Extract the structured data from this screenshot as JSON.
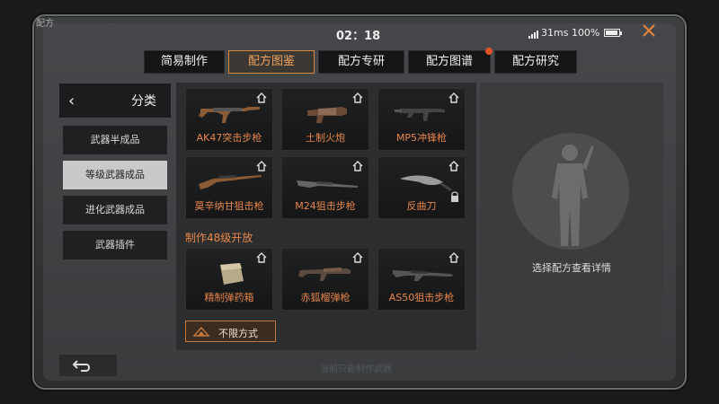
{
  "status": {
    "title": "配方",
    "clock": "02：18",
    "network": "31ms 100%"
  },
  "tabs": [
    {
      "label": "简易制作",
      "active": false
    },
    {
      "label": "配方图鉴",
      "active": true
    },
    {
      "label": "配方专研",
      "active": false
    },
    {
      "label": "配方图谱",
      "active": false,
      "badge": true
    },
    {
      "label": "配方研究",
      "active": false
    }
  ],
  "sidebar": {
    "header": "分类",
    "items": [
      {
        "label": "武器半成品",
        "active": false
      },
      {
        "label": "等级武器成品",
        "active": true
      },
      {
        "label": "进化武器成品",
        "active": false
      },
      {
        "label": "武器插件",
        "active": false
      }
    ]
  },
  "cards": [
    {
      "name": "AK47突击步枪",
      "icon": "rifle-icon"
    },
    {
      "name": "土制火炮",
      "icon": "cannon-icon"
    },
    {
      "name": "MP5冲锋枪",
      "icon": "smg-icon"
    },
    {
      "name": "莫辛纳甘狙击枪",
      "icon": "sniper-icon"
    },
    {
      "name": "M24狙击步枪",
      "icon": "sniper-icon"
    },
    {
      "name": "反曲刀",
      "icon": "machete-icon",
      "locked": true
    },
    {
      "name": "精制弹药箱",
      "icon": "ammo-box-icon"
    },
    {
      "name": "赤狐榴弹枪",
      "icon": "grenade-launcher-icon"
    },
    {
      "name": "AS50狙击步枪",
      "icon": "sniper-icon"
    }
  ],
  "section_label": "制作48级开放",
  "filter_button": "不限方式",
  "detail_hint": "选择配方查看详情",
  "bottom_faint_text": "当前只能制作武器",
  "colors": {
    "accent": "#e8864a",
    "tab_active_border": "#d9863a",
    "badge": "#e0522a"
  }
}
